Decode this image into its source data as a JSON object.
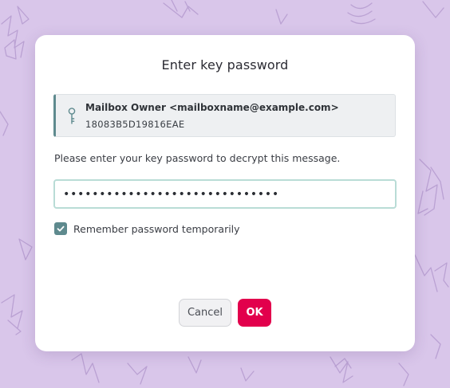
{
  "dialog": {
    "title": "Enter key password",
    "key": {
      "icon": "key-icon",
      "owner": "Mailbox Owner <mailboxname@example.com>",
      "key_id": "18083B5D19816EAE"
    },
    "prompt": "Please enter your key password to decrypt this message.",
    "password_value": "••••••••••••••••••••••••••••••",
    "remember": {
      "checked": true,
      "label": "Remember password temporarily"
    },
    "buttons": {
      "cancel_label": "Cancel",
      "ok_label": "OK"
    }
  },
  "colors": {
    "background": "#d9c6ea",
    "accent": "#5e8a8e",
    "primary_button": "#e2004c",
    "input_focus_border": "#b9dcd6"
  }
}
